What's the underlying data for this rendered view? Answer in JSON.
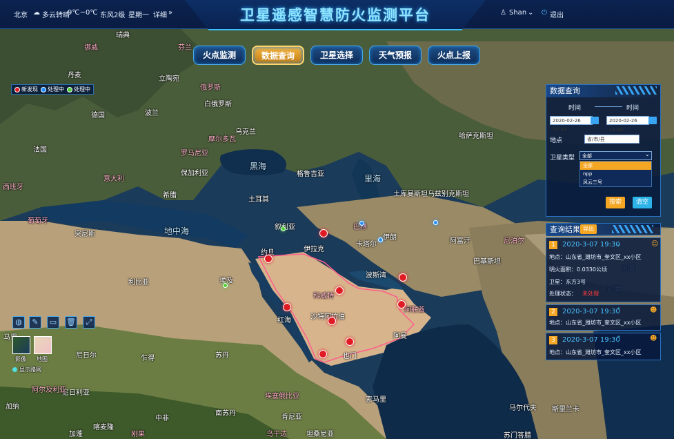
{
  "header": {
    "city": "北京",
    "weather": "多云转晴",
    "temp": "9℃~0℃",
    "wind": "东风2级",
    "weekday": "星期一",
    "detail": "详细",
    "title": "卫星遥感智慧防火监测平台",
    "user": "Shan",
    "logout": "退出"
  },
  "nav": [
    "火点监测",
    "数据查询",
    "卫星选择",
    "天气预报",
    "火点上报"
  ],
  "legend": [
    {
      "label": "新发现",
      "color": "#e01b24"
    },
    {
      "label": "处理中",
      "color": "#1e8fff"
    },
    {
      "label": "处理中",
      "color": "#4fce3a"
    }
  ],
  "query": {
    "title": "数据查询",
    "time_label_1": "时间",
    "time_label_2": "时间",
    "time_start": "2020-02-26 15:30",
    "time_end": "2020-02-26 15:30",
    "place_label": "地点",
    "place_value": "省/市/县",
    "sat_label": "卫星类型",
    "sat_selected": "全部",
    "sat_options": [
      "全部",
      "npp",
      "风云三号"
    ],
    "search": "搜索",
    "clear": "清空"
  },
  "results": {
    "title": "查询结果",
    "export": "导出",
    "items": [
      {
        "n": "1",
        "date": "2020-3-07 19:30",
        "addr": "地点：山东省_潍坊市_奎文区_xx小区",
        "area": "明火面积：0.0330公顷",
        "sat": "卫星：东方3号",
        "status_label": "处理状态：",
        "status": "未处理"
      },
      {
        "n": "2",
        "date": "2020-3-07 19:30",
        "addr": "地点：山东省_潍坊市_奎文区_xx小区"
      },
      {
        "n": "3",
        "date": "2020-3-07 19:30",
        "addr": "地点：山东省_潍坊市_奎文区_xx小区"
      }
    ]
  },
  "map_tools": {
    "img_label": "影像",
    "map_label": "地图",
    "road_label": "显示路网"
  },
  "map_labels": [
    "瑞典",
    "挪威",
    "芬兰",
    "俄罗斯",
    "丹麦",
    "立陶宛",
    "白俄罗斯",
    "波兰",
    "德国",
    "乌克兰",
    "法国",
    "摩尔多瓦",
    "罗马尼亚",
    "保加利亚",
    "意大利",
    "黑海",
    "格鲁吉亚",
    "里海",
    "土耳其",
    "希腊",
    "哈萨克斯坦",
    "乌兹别克斯坦",
    "土库曼斯坦",
    "突尼斯",
    "叙利亚",
    "伊拉克",
    "伊朗",
    "阿富汗",
    "地中海",
    "约旦",
    "巴基斯坦",
    "利比亚",
    "埃及",
    "沙特阿拉伯",
    "阿曼",
    "也门",
    "苏丹",
    "尼日尔",
    "乍得",
    "马里",
    "尼日利亚",
    "中非",
    "南苏丹",
    "埃塞俄比亚",
    "索马里",
    "肯尼亚",
    "阿尔及利亚",
    "西班牙",
    "葡萄牙",
    "科威特",
    "波斯湾",
    "红海",
    "印度",
    "尼泊尔",
    "中国",
    "巴林",
    "卡塔尔",
    "阿联酋",
    "马尔代夫",
    "斯里兰卡",
    "乌干达",
    "苏门答腊",
    "加纳",
    "喀麦隆",
    "刚果",
    "加蓬",
    "坦桑尼亚"
  ]
}
